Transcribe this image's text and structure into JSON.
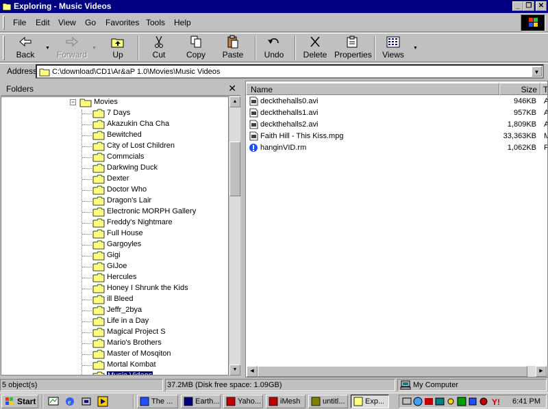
{
  "window": {
    "title": "Exploring - Music Videos"
  },
  "menu": [
    {
      "key": "F",
      "rest": "ile"
    },
    {
      "key": "E",
      "rest": "dit"
    },
    {
      "key": "V",
      "rest": "iew"
    },
    {
      "key": "G",
      "rest": "o"
    },
    {
      "key": "",
      "rest": "Favorites",
      "pre": "F",
      "post": "avorites"
    },
    {
      "key": "T",
      "rest": "ools"
    },
    {
      "key": "H",
      "rest": "elp"
    }
  ],
  "menu_labels": {
    "file": "File",
    "edit": "Edit",
    "view": "View",
    "go": "Go",
    "favorites": "Favorites",
    "tools": "Tools",
    "help": "Help"
  },
  "toolbar": {
    "back": "Back",
    "forward": "Forward",
    "up": "Up",
    "cut": "Cut",
    "copy": "Copy",
    "paste": "Paste",
    "undo": "Undo",
    "delete": "Delete",
    "properties": "Properties",
    "views": "Views"
  },
  "address": {
    "label": "Address",
    "value": "C:\\download\\CD1\\Ar&aP 1.0\\Movies\\Music Videos"
  },
  "folders": {
    "title": "Folders",
    "root": "Movies",
    "items": [
      "7 Days",
      "Akazukin Cha Cha",
      "Bewitched",
      "City of Lost Children",
      "Commcials",
      "Darkwing Duck",
      "Dexter",
      "Doctor Who",
      "Dragon's Lair",
      "Electronic MORPH Gallery",
      "Freddy's Nightmare",
      "Full House",
      "Gargoyles",
      "Gigi",
      "GIJoe",
      "Hercules",
      "Honey I Shrunk the Kids",
      "ill Bleed",
      "Jeffr_2bya",
      "Life in a Day",
      "Magical Project S",
      "Mario's Brothers",
      "Master of Mosqiton",
      "Mortal Kombat",
      "Music Videos"
    ],
    "selected": "Music Videos"
  },
  "files": {
    "columns": {
      "name": "Name",
      "size": "Size",
      "type": "T"
    },
    "rows": [
      {
        "name": "deckthehalls0.avi",
        "size": "946KB",
        "type": "A",
        "icon": "video-file-icon"
      },
      {
        "name": "deckthehalls1.avi",
        "size": "957KB",
        "type": "A",
        "icon": "video-file-icon"
      },
      {
        "name": "deckthehalls2.avi",
        "size": "1,809KB",
        "type": "A",
        "icon": "video-file-icon"
      },
      {
        "name": "Faith Hill - This  Kiss.mpg",
        "size": "33,363KB",
        "type": "M",
        "icon": "video-file-icon"
      },
      {
        "name": "hanginVID.rm",
        "size": "1,062KB",
        "type": "F",
        "icon": "realmedia-icon"
      }
    ]
  },
  "status": {
    "objects": "5 object(s)",
    "size": "37.2MB (Disk free space: 1.09GB)",
    "location": "My Computer"
  },
  "taskbar": {
    "start": "Start",
    "tasks": [
      {
        "label": "The ...",
        "icon": "document-icon"
      },
      {
        "label": "Earth...",
        "icon": "globe-icon"
      },
      {
        "label": "Yaho...",
        "icon": "yahoo-messenger-icon"
      },
      {
        "label": "iMesh",
        "icon": "imesh-icon"
      },
      {
        "label": "untitl...",
        "icon": "paint-icon"
      },
      {
        "label": "Exp...",
        "icon": "explorer-folder-icon"
      }
    ],
    "clock": "6:41 PM"
  },
  "colors": {
    "titlebar": "#000080",
    "selection": "#000080",
    "face": "#c0c0c0"
  }
}
